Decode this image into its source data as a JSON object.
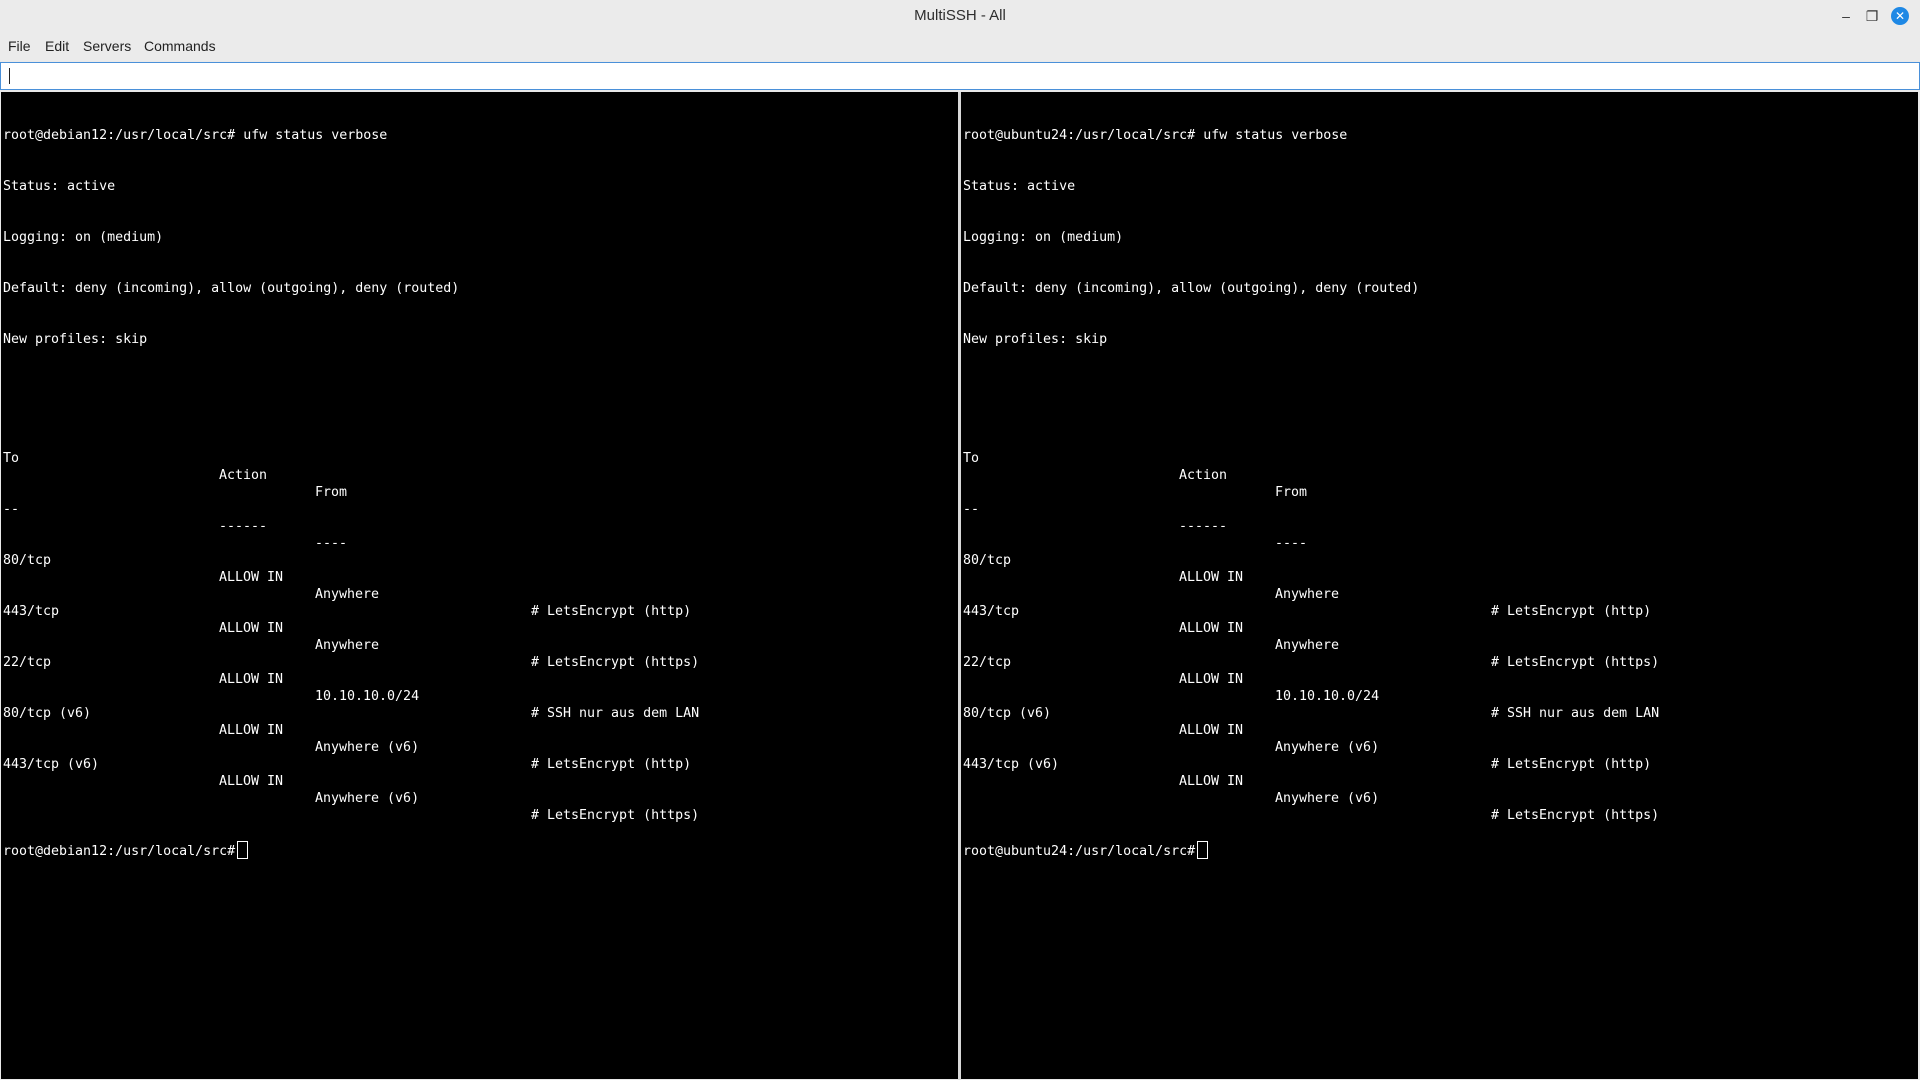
{
  "window": {
    "title": "MultiSSH - All"
  },
  "menu": [
    "File",
    "Edit",
    "Servers",
    "Commands"
  ],
  "command_input": {
    "value": ""
  },
  "panes": [
    {
      "prompt": "root@debian12:/usr/local/src#",
      "command": "ufw status verbose",
      "status": "Status: active",
      "logging": "Logging: on (medium)",
      "default": "Default: deny (incoming), allow (outgoing), deny (routed)",
      "profiles": "New profiles: skip",
      "header": {
        "to": "To",
        "action": "Action",
        "from": "From"
      },
      "underline": {
        "to": "--",
        "action": "------",
        "from": "----"
      },
      "rules": [
        {
          "to": "80/tcp",
          "action": "ALLOW IN",
          "from": "Anywhere",
          "comment": "# LetsEncrypt (http)"
        },
        {
          "to": "443/tcp",
          "action": "ALLOW IN",
          "from": "Anywhere",
          "comment": "# LetsEncrypt (https)"
        },
        {
          "to": "22/tcp",
          "action": "ALLOW IN",
          "from": "10.10.10.0/24",
          "comment": "# SSH nur aus dem LAN"
        },
        {
          "to": "80/tcp (v6)",
          "action": "ALLOW IN",
          "from": "Anywhere (v6)",
          "comment": "# LetsEncrypt (http)"
        },
        {
          "to": "443/tcp (v6)",
          "action": "ALLOW IN",
          "from": "Anywhere (v6)",
          "comment": "# LetsEncrypt (https)"
        }
      ]
    },
    {
      "prompt": "root@ubuntu24:/usr/local/src#",
      "command": "ufw status verbose",
      "status": "Status: active",
      "logging": "Logging: on (medium)",
      "default": "Default: deny (incoming), allow (outgoing), deny (routed)",
      "profiles": "New profiles: skip",
      "header": {
        "to": "To",
        "action": "Action",
        "from": "From"
      },
      "underline": {
        "to": "--",
        "action": "------",
        "from": "----"
      },
      "rules": [
        {
          "to": "80/tcp",
          "action": "ALLOW IN",
          "from": "Anywhere",
          "comment": "# LetsEncrypt (http)"
        },
        {
          "to": "443/tcp",
          "action": "ALLOW IN",
          "from": "Anywhere",
          "comment": "# LetsEncrypt (https)"
        },
        {
          "to": "22/tcp",
          "action": "ALLOW IN",
          "from": "10.10.10.0/24",
          "comment": "# SSH nur aus dem LAN"
        },
        {
          "to": "80/tcp (v6)",
          "action": "ALLOW IN",
          "from": "Anywhere (v6)",
          "comment": "# LetsEncrypt (http)"
        },
        {
          "to": "443/tcp (v6)",
          "action": "ALLOW IN",
          "from": "Anywhere (v6)",
          "comment": "# LetsEncrypt (https)"
        }
      ]
    }
  ]
}
